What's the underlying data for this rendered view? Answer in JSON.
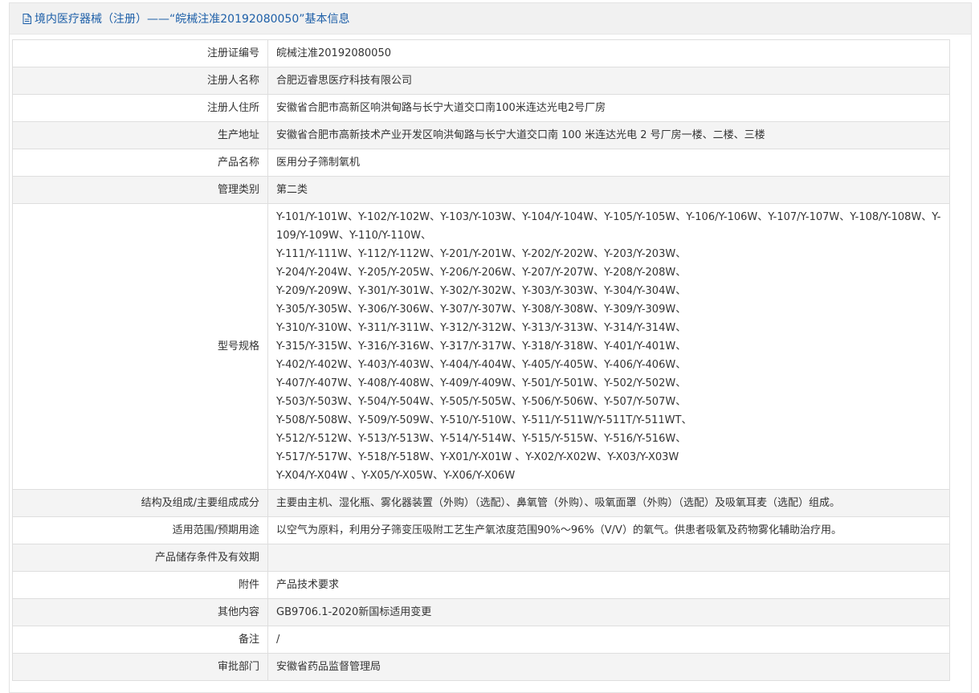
{
  "header": {
    "title": "境内医疗器械（注册）——“皖械注准20192080050”基本信息",
    "icon": "document-icon",
    "color": "#1d5fa8"
  },
  "rows": [
    {
      "label": "注册证编号",
      "value": "皖械注准20192080050"
    },
    {
      "label": "注册人名称",
      "value": "合肥迈睿思医疗科技有限公司"
    },
    {
      "label": "注册人住所",
      "value": "安徽省合肥市高新区响洪甸路与长宁大道交口南100米连达光电2号厂房"
    },
    {
      "label": "生产地址",
      "value": "安徽省合肥市高新技术产业开发区响洪甸路与长宁大道交口南 100 米连达光电 2 号厂房一楼、二楼、三楼"
    },
    {
      "label": "产品名称",
      "value": "医用分子筛制氧机"
    },
    {
      "label": "管理类别",
      "value": "第二类"
    },
    {
      "label": "型号规格",
      "value": ""
    },
    {
      "label": "结构及组成/主要组成成分",
      "value": "主要由主机、湿化瓶、雾化器装置（外购）（选配）、鼻氧管（外购）、吸氧面罩（外购）（选配）及吸氧耳麦（选配）组成。"
    },
    {
      "label": "适用范围/预期用途",
      "value": "以空气为原料，利用分子筛变压吸附工艺生产氧浓度范围90%～96%（V/V）的氧气。供患者吸氧及药物雾化辅助治疗用。"
    },
    {
      "label": "产品储存条件及有效期",
      "value": ""
    },
    {
      "label": "附件",
      "value": "产品技术要求"
    },
    {
      "label": "其他内容",
      "value": "GB9706.1-2020新国标适用变更"
    },
    {
      "label": "备注",
      "value": "/"
    },
    {
      "label": "审批部门",
      "value": "安徽省药品监督管理局"
    }
  ],
  "models_lines": [
    "Y-101/Y-101W、Y-102/Y-102W、Y-103/Y-103W、Y-104/Y-104W、Y-105/Y-105W、Y-106/Y-106W、Y-107/Y-107W、Y-108/Y-108W、Y-109/Y-109W、Y-110/Y-110W、",
    "Y-111/Y-111W、Y-112/Y-112W、Y-201/Y-201W、Y-202/Y-202W、Y-203/Y-203W、",
    "Y-204/Y-204W、Y-205/Y-205W、Y-206/Y-206W、Y-207/Y-207W、Y-208/Y-208W、",
    "Y-209/Y-209W、Y-301/Y-301W、Y-302/Y-302W、Y-303/Y-303W、Y-304/Y-304W、",
    "Y-305/Y-305W、Y-306/Y-306W、Y-307/Y-307W、Y-308/Y-308W、Y-309/Y-309W、",
    "Y-310/Y-310W、Y-311/Y-311W、Y-312/Y-312W、Y-313/Y-313W、Y-314/Y-314W、",
    "Y-315/Y-315W、Y-316/Y-316W、Y-317/Y-317W、Y-318/Y-318W、Y-401/Y-401W、",
    "Y-402/Y-402W、Y-403/Y-403W、Y-404/Y-404W、Y-405/Y-405W、Y-406/Y-406W、",
    "Y-407/Y-407W、Y-408/Y-408W、Y-409/Y-409W、Y-501/Y-501W、Y-502/Y-502W、",
    "Y-503/Y-503W、Y-504/Y-504W、Y-505/Y-505W、Y-506/Y-506W、Y-507/Y-507W、",
    "Y-508/Y-508W、Y-509/Y-509W、Y-510/Y-510W、Y-511/Y-511W/Y-511T/Y-511WT、",
    "Y-512/Y-512W、Y-513/Y-513W、Y-514/Y-514W、Y-515/Y-515W、Y-516/Y-516W、",
    "Y-517/Y-517W、Y-518/Y-518W、Y-X01/Y-X01W 、Y-X02/Y-X02W、Y-X03/Y-X03W",
    "Y-X04/Y-X04W 、Y-X05/Y-X05W、Y-X06/Y-X06W"
  ]
}
